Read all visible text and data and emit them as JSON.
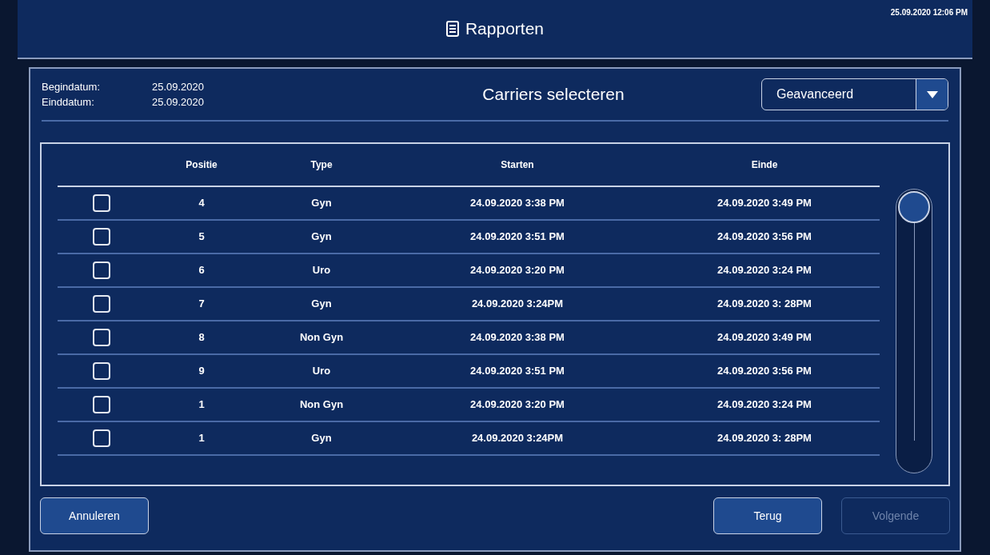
{
  "header": {
    "title": "Rapporten",
    "datetime": "25.09.2020 12:06 PM"
  },
  "dates": [
    {
      "label": "Begindatum:",
      "value": "25.09.2020"
    },
    {
      "label": "Einddatum:",
      "value": "25.09.2020"
    }
  ],
  "panel_title": "Carriers selecteren",
  "mode_dropdown": {
    "value": "Geavanceerd"
  },
  "table": {
    "columns": [
      "Positie",
      "Type",
      "Starten",
      "Einde"
    ],
    "rows": [
      {
        "checked": false,
        "cells": [
          "4",
          "Gyn",
          "24.09.2020 3:38 PM",
          "24.09.2020 3:49 PM"
        ]
      },
      {
        "checked": false,
        "cells": [
          "5",
          "Gyn",
          "24.09.2020 3:51 PM",
          "24.09.2020 3:56 PM"
        ]
      },
      {
        "checked": false,
        "cells": [
          "6",
          "Uro",
          "24.09.2020 3:20 PM",
          "24.09.2020 3:24 PM"
        ]
      },
      {
        "checked": false,
        "cells": [
          "7",
          "Gyn",
          "24.09.2020 3:24PM",
          "24.09.2020 3: 28PM"
        ]
      },
      {
        "checked": false,
        "cells": [
          "8",
          "Non Gyn",
          "24.09.2020 3:38 PM",
          "24.09.2020 3:49 PM"
        ]
      },
      {
        "checked": false,
        "cells": [
          "9",
          "Uro",
          "24.09.2020 3:51 PM",
          "24.09.2020 3:56 PM"
        ]
      },
      {
        "checked": false,
        "cells": [
          "1",
          "Non Gyn",
          "24.09.2020 3:20 PM",
          "24.09.2020 3:24 PM"
        ]
      },
      {
        "checked": false,
        "cells": [
          "1",
          "Gyn",
          "24.09.2020 3:24PM",
          "24.09.2020 3: 28PM"
        ]
      }
    ]
  },
  "buttons": [
    {
      "label": "Annuleren",
      "disabled": false
    },
    {
      "label": "Terug",
      "disabled": false
    },
    {
      "label": "Volgende",
      "disabled": true
    }
  ]
}
